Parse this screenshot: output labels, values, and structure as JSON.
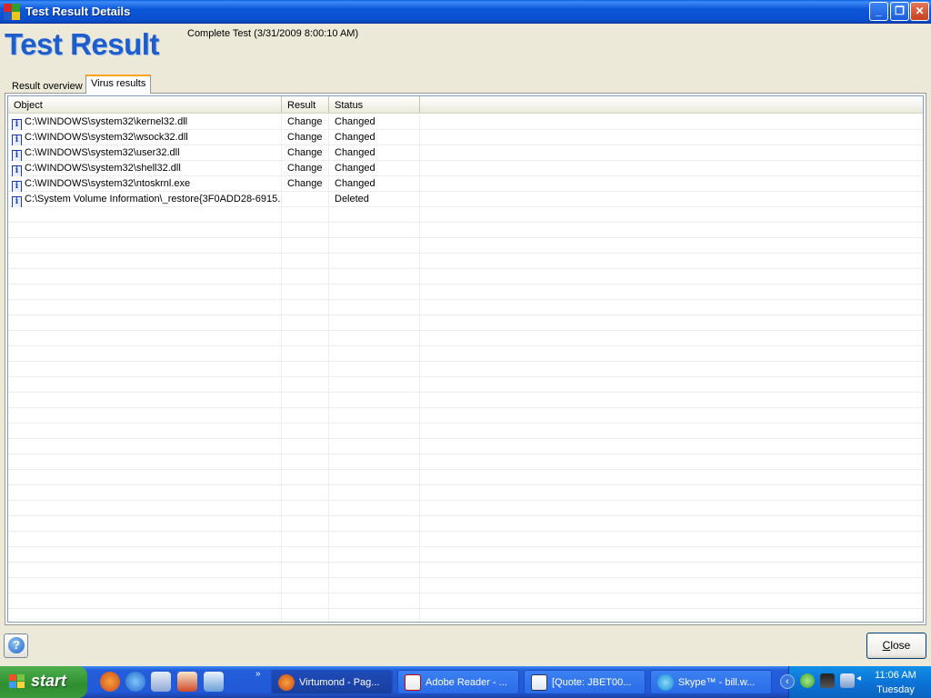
{
  "window": {
    "title": "Test Result Details",
    "min_label": "_",
    "max_label": "❐",
    "close_label": "✕"
  },
  "header": {
    "title": "Test Result",
    "subtitle": "Complete Test (3/31/2009 8:00:10 AM)"
  },
  "tabs": [
    {
      "label": "Result overview",
      "active": false
    },
    {
      "label": "Virus results",
      "active": true
    }
  ],
  "table": {
    "columns": [
      "Object",
      "Result",
      "Status"
    ],
    "rows": [
      {
        "object": "C:\\WINDOWS\\system32\\kernel32.dll",
        "result": "Change",
        "status": "Changed"
      },
      {
        "object": "C:\\WINDOWS\\system32\\wsock32.dll",
        "result": "Change",
        "status": "Changed"
      },
      {
        "object": "C:\\WINDOWS\\system32\\user32.dll",
        "result": "Change",
        "status": "Changed"
      },
      {
        "object": "C:\\WINDOWS\\system32\\shell32.dll",
        "result": "Change",
        "status": "Changed"
      },
      {
        "object": "C:\\WINDOWS\\system32\\ntoskrnl.exe",
        "result": "Change",
        "status": "Changed"
      },
      {
        "object": "C:\\System Volume Information\\_restore{3F0ADD28-6915...",
        "result": "",
        "status": "Deleted"
      }
    ],
    "row_icon": "info-icon"
  },
  "footer": {
    "help_label": "?",
    "close_label": "Close"
  },
  "taskbar": {
    "start_label": "start",
    "quick_launch": [
      "firefox-icon",
      "ie-icon",
      "outlook-icon",
      "app-icon",
      "explorer-icon"
    ],
    "tasks": [
      {
        "label": "Virtumond - Pag...",
        "icon": "firefox-icon",
        "active": true
      },
      {
        "label": "Adobe Reader - ...",
        "icon": "adobe-reader-icon",
        "active": false
      },
      {
        "label": "[Quote: JBET00...",
        "icon": "document-icon",
        "active": false
      },
      {
        "label": "Skype™ - bill.w...",
        "icon": "skype-icon",
        "active": false
      }
    ],
    "tray": {
      "time": "11:06 AM",
      "day": "Tuesday"
    }
  },
  "colors": {
    "title_blue": "#1E5ECC",
    "xp_titlebar": "#0B56D8",
    "start_green": "#3B9A3B"
  }
}
